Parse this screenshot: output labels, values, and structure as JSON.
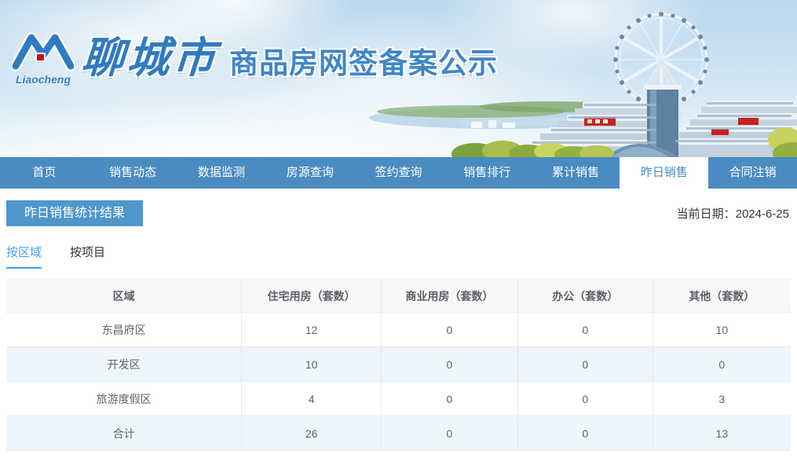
{
  "colors": {
    "nav_blue": "#4a8bc2",
    "banner_blue": "#4f96cc",
    "accent_blue": "#409eff",
    "logo_blue": "#2f7bc3",
    "logo_red": "#cc1111",
    "zebra_row": "#eef6fd",
    "table_header_bg": "#f8f8f9",
    "table_border": "#e8eaec"
  },
  "header": {
    "logo_script": "Liaocheng",
    "city_name": "聊城市",
    "site_title": "商品房网签备案公示"
  },
  "nav": {
    "items": [
      {
        "label": "首页",
        "active": false
      },
      {
        "label": "销售动态",
        "active": false
      },
      {
        "label": "数据监测",
        "active": false
      },
      {
        "label": "房源查询",
        "active": false
      },
      {
        "label": "签约查询",
        "active": false
      },
      {
        "label": "销售排行",
        "active": false
      },
      {
        "label": "累计销售",
        "active": false
      },
      {
        "label": "昨日销售",
        "active": true
      },
      {
        "label": "合同注销",
        "active": false
      }
    ]
  },
  "page": {
    "section_title": "昨日销售统计结果",
    "date_label": "当前日期：",
    "date_value": "2024-6-25"
  },
  "tabs": {
    "items": [
      {
        "label": "按区域",
        "active": true
      },
      {
        "label": "按项目",
        "active": false
      }
    ]
  },
  "table": {
    "columns": [
      "区域",
      "住宅用房（套数）",
      "商业用房（套数）",
      "办公（套数）",
      "其他（套数）"
    ],
    "rows": [
      [
        "东昌府区",
        "12",
        "0",
        "0",
        "10"
      ],
      [
        "开发区",
        "10",
        "0",
        "0",
        "0"
      ],
      [
        "旅游度假区",
        "4",
        "0",
        "0",
        "3"
      ],
      [
        "合计",
        "26",
        "0",
        "0",
        "13"
      ]
    ]
  }
}
